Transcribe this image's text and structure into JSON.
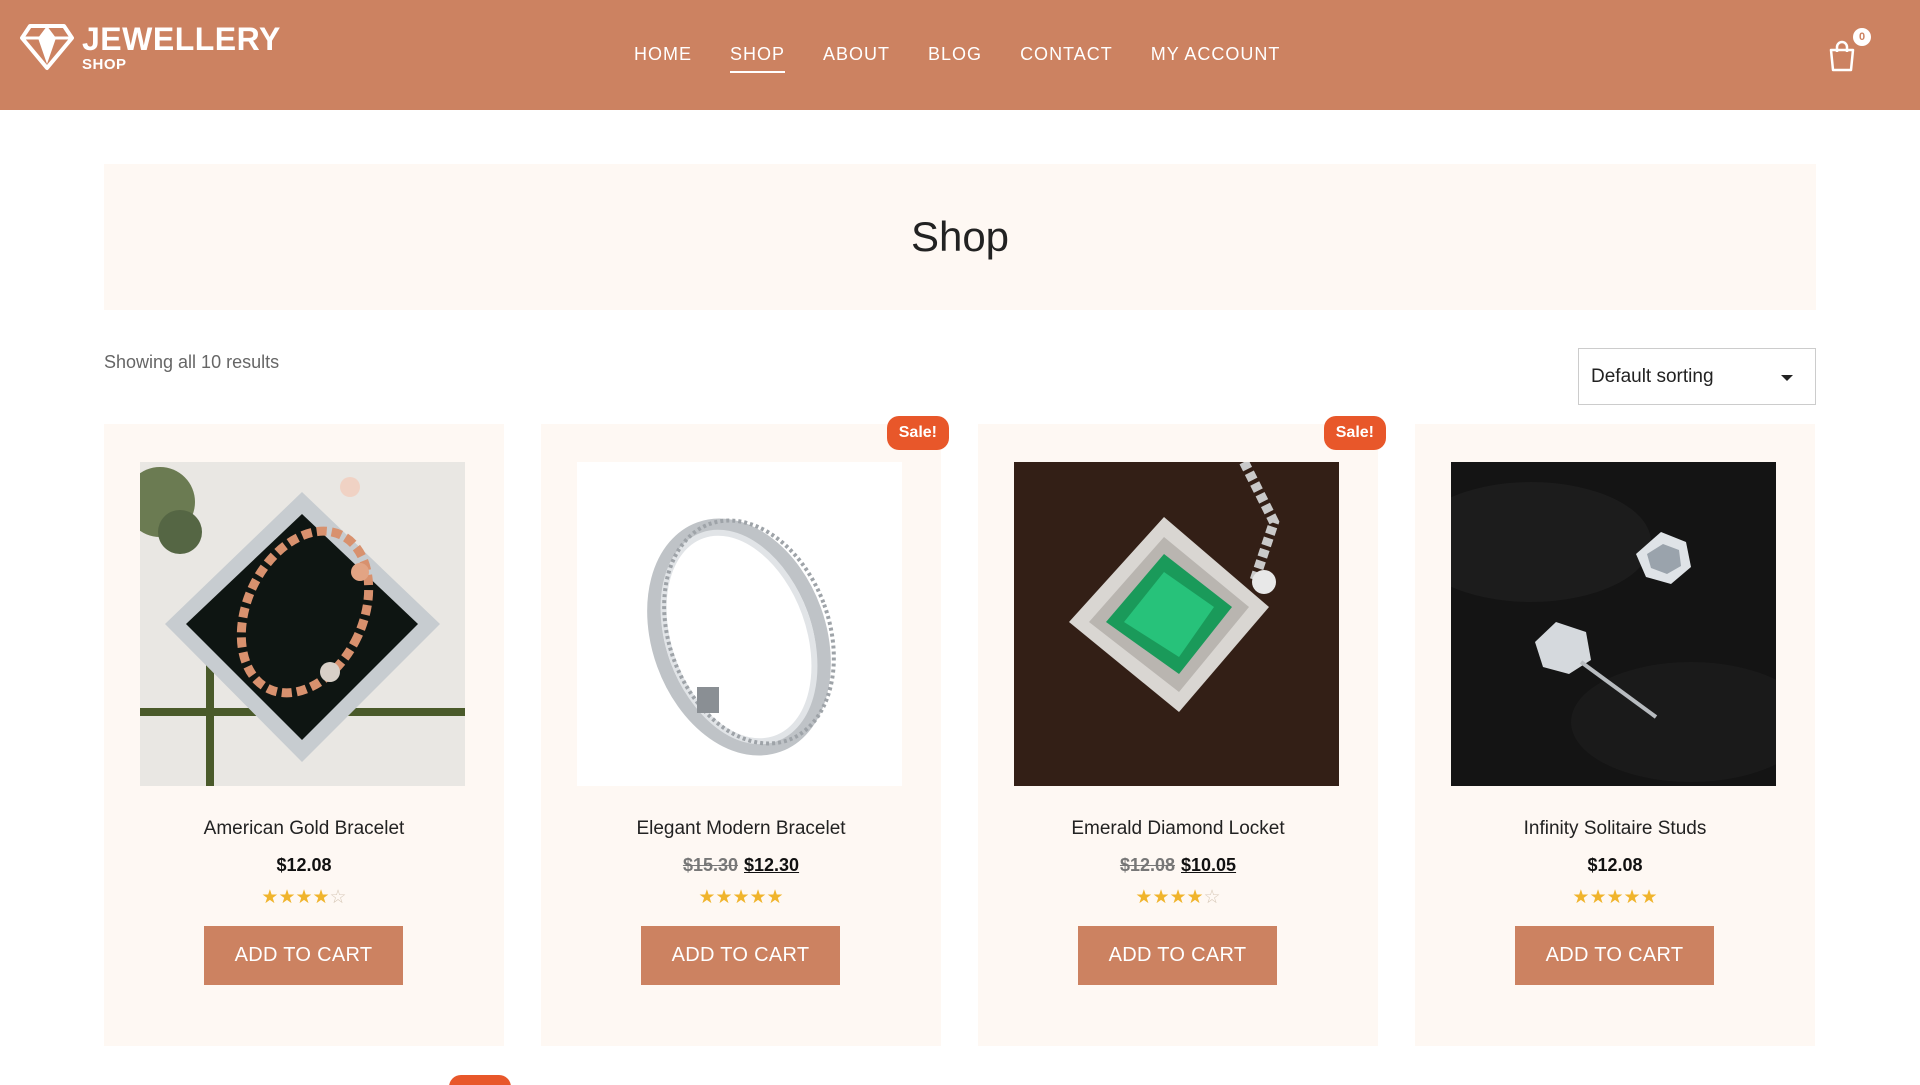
{
  "brand": {
    "title": "JEWELLERY",
    "subtitle": "SHOP"
  },
  "nav": [
    {
      "label": "HOME",
      "active": false
    },
    {
      "label": "SHOP",
      "active": true
    },
    {
      "label": "ABOUT",
      "active": false
    },
    {
      "label": "BLOG",
      "active": false
    },
    {
      "label": "CONTACT",
      "active": false
    },
    {
      "label": "MY ACCOUNT",
      "active": false
    }
  ],
  "cart": {
    "count": "0",
    "icon": "shopping-bag-icon"
  },
  "page": {
    "title": "Shop"
  },
  "results": "Showing all 10 results",
  "sorting": {
    "selected": "Default sorting"
  },
  "colors": {
    "accent": "#cc8261",
    "sale": "#e8572a",
    "card_bg": "#fef8f3",
    "star": "#f0b42c"
  },
  "products": [
    {
      "title": "American Gold Bracelet",
      "price": "$12.08",
      "old_price": "",
      "sale_label": "",
      "rating": 4,
      "button": "ADD TO CART"
    },
    {
      "title": "Elegant Modern Bracelet",
      "price": "$12.30",
      "old_price": "$15.30",
      "sale_label": "Sale!",
      "rating": 5,
      "button": "ADD TO CART"
    },
    {
      "title": "Emerald Diamond Locket",
      "price": "$10.05",
      "old_price": "$12.08",
      "sale_label": "Sale!",
      "rating": 4,
      "button": "ADD TO CART"
    },
    {
      "title": "Infinity Solitaire Studs",
      "price": "$12.08",
      "old_price": "",
      "sale_label": "",
      "rating": 5,
      "button": "ADD TO CART"
    }
  ]
}
